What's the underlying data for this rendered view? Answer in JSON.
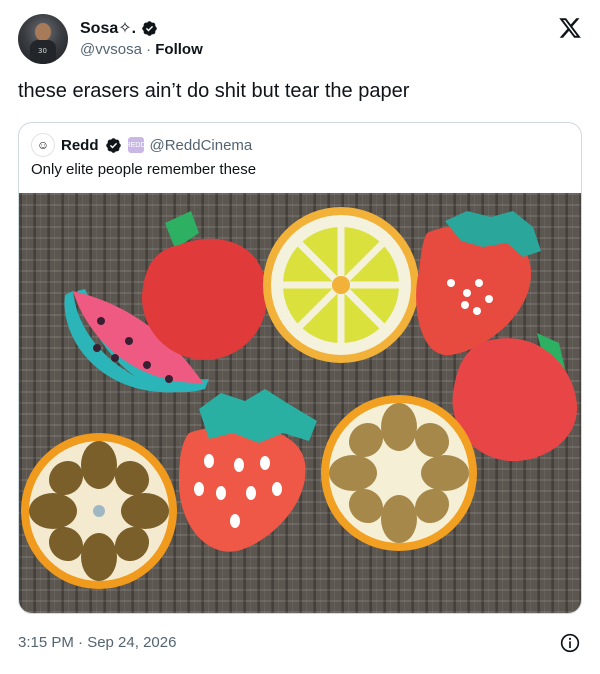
{
  "author": {
    "name": "Sosa✧.",
    "handle": "@vvsosa",
    "separator": " · ",
    "follow_label": "Follow",
    "avatar_number": "30"
  },
  "tweet": {
    "text": "these erasers ain’t do shit but tear the paper",
    "timestamp": "3:15 PM · Sep 24, 2026"
  },
  "quoted": {
    "name": "Redd",
    "badge_text": "REDD",
    "handle": "@ReddCinema",
    "text": "Only elite people remember these"
  },
  "colors": {
    "verified": "#0f1419",
    "link": "#1d9bf0",
    "muted": "#536471"
  },
  "icons": [
    "x-logo-icon",
    "verified-icon",
    "info-icon"
  ]
}
